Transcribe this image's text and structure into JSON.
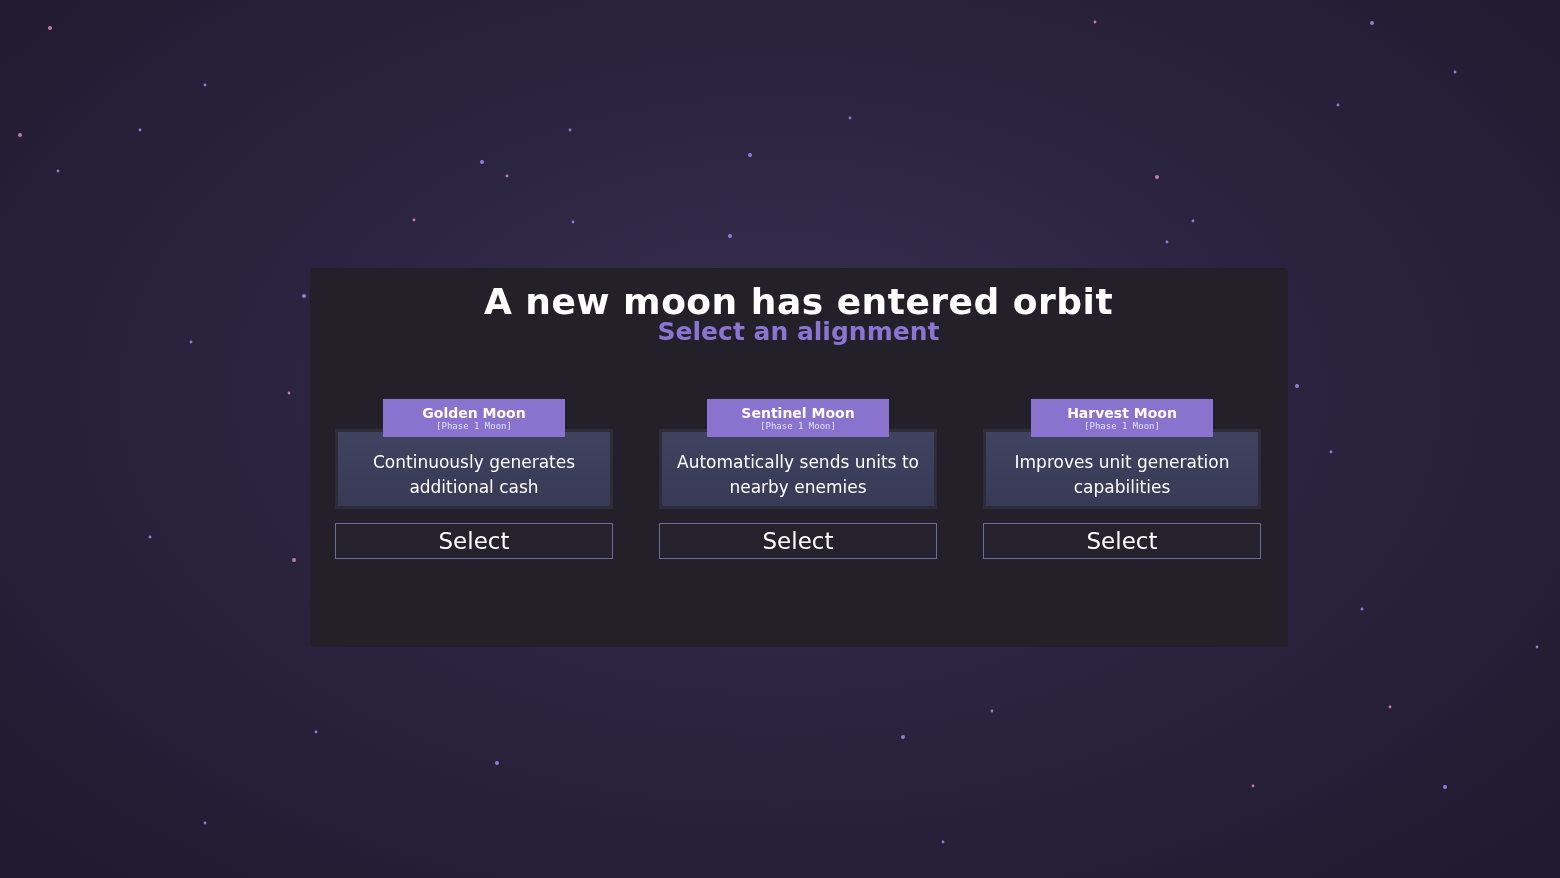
{
  "dialog": {
    "title": "A new moon has entered orbit",
    "subtitle": "Select an alignment",
    "options": [
      {
        "name": "Golden Moon",
        "phase": "[Phase 1 Moon]",
        "description": "Continuously generates additional cash",
        "button": "Select"
      },
      {
        "name": "Sentinel Moon",
        "phase": "[Phase 1 Moon]",
        "description": "Automatically sends units to nearby enemies",
        "button": "Select"
      },
      {
        "name": "Harvest Moon",
        "phase": "[Phase 1 Moon]",
        "description": "Improves unit generation capabilities",
        "button": "Select"
      }
    ]
  }
}
